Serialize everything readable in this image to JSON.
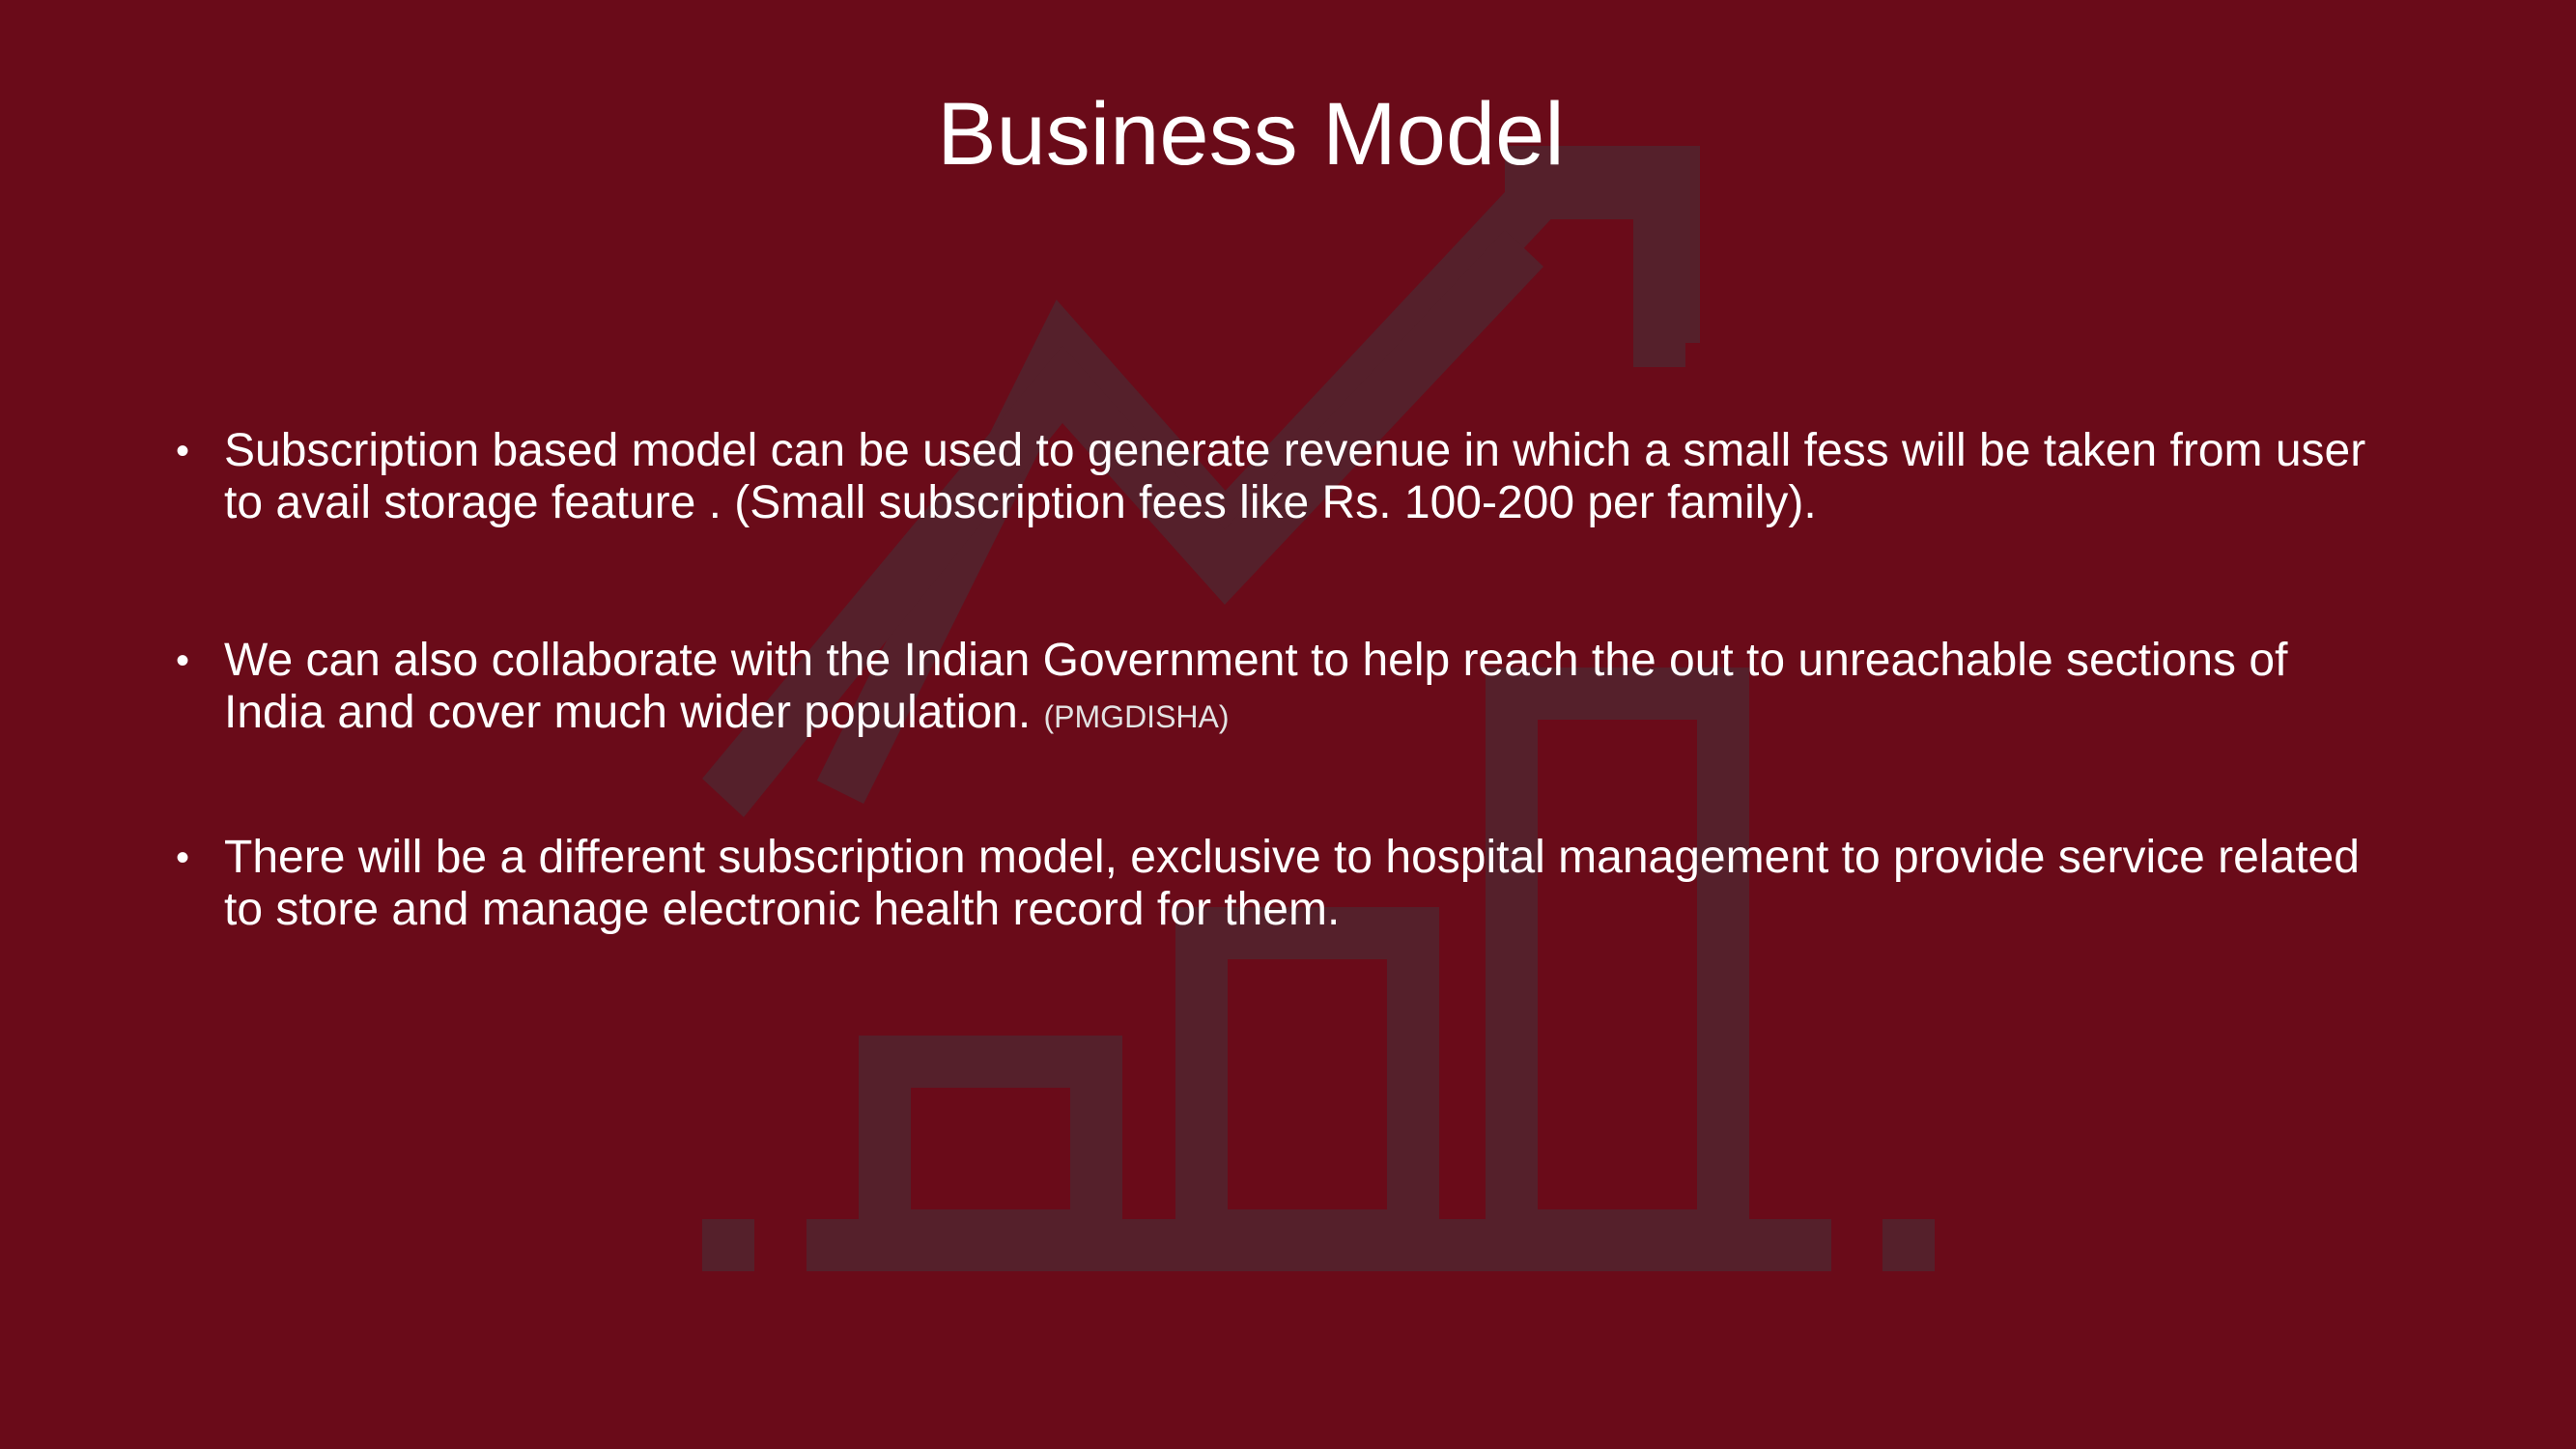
{
  "slide": {
    "title": "Business Model",
    "background_color": "#6a0b19",
    "background_icon": "growth-chart-icon",
    "bullet_glyph": "•",
    "bullets": [
      {
        "text": "Subscription based model can be used to generate revenue in which a small fess will be taken from user to avail storage feature  . (Small subscription fees like Rs. 100-200 per family)."
      },
      {
        "text": "We can also collaborate with the Indian Government to help reach the out to unreachable sections of India and cover much wider population. ",
        "note": "(PMGDISHA)"
      },
      {
        "text": "There will be a different subscription model, exclusive to hospital management to provide service related to store and manage electronic health record for them."
      }
    ]
  }
}
